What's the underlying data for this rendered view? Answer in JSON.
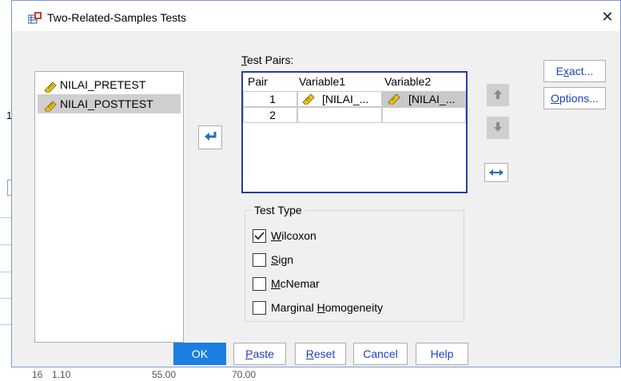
{
  "window": {
    "title": "Two-Related-Samples Tests",
    "close_glyph": "✕"
  },
  "source_variables": [
    {
      "label": "NILAI_PRETEST",
      "selected": false
    },
    {
      "label": "NILAI_POSTTEST",
      "selected": true
    }
  ],
  "test_pairs": {
    "label_prefix": "T",
    "label_rest": "est Pairs:",
    "headers": [
      "Pair",
      "Variable1",
      "Variable2"
    ],
    "rows": [
      {
        "pair": "1",
        "variable1": "[NILAI_...",
        "variable2": "[NILAI_..."
      },
      {
        "pair": "2",
        "variable1": "",
        "variable2": ""
      }
    ]
  },
  "right_buttons": {
    "exact": {
      "pre": "E",
      "u": "x",
      "post": "act..."
    },
    "options": {
      "pre": "",
      "u": "O",
      "post": "ptions..."
    }
  },
  "test_type": {
    "title": "Test Type",
    "items": [
      {
        "pre": "",
        "u": "W",
        "post": "ilcoxon",
        "checked": true
      },
      {
        "pre": "",
        "u": "S",
        "post": "ign",
        "checked": false
      },
      {
        "pre": "",
        "u": "M",
        "post": "cNemar",
        "checked": false
      },
      {
        "pre": "Marginal ",
        "u": "H",
        "post": "omogeneity",
        "checked": false
      }
    ]
  },
  "bottom_buttons": {
    "ok": "OK",
    "paste": {
      "u": "P",
      "post": "aste"
    },
    "reset": {
      "u": "R",
      "post": "eset"
    },
    "cancel": "Cancel",
    "help": "Help"
  },
  "background_app": {
    "row_number": "1",
    "footer_fragments": [
      "16",
      "1.10",
      "55.00",
      "70.00"
    ]
  },
  "colors": {
    "accent": "#1a7fe0",
    "grid_border": "#2a3aa8",
    "link_text": "#1f3fbf",
    "ruler_yellow": "#e8c020"
  },
  "icons": {
    "variable": "ruler-scale-icon",
    "move_arrow": "arrow-left-return-icon",
    "move_up": "arrow-up-icon",
    "move_down": "arrow-down-icon",
    "swap": "swap-horizontal-icon"
  }
}
